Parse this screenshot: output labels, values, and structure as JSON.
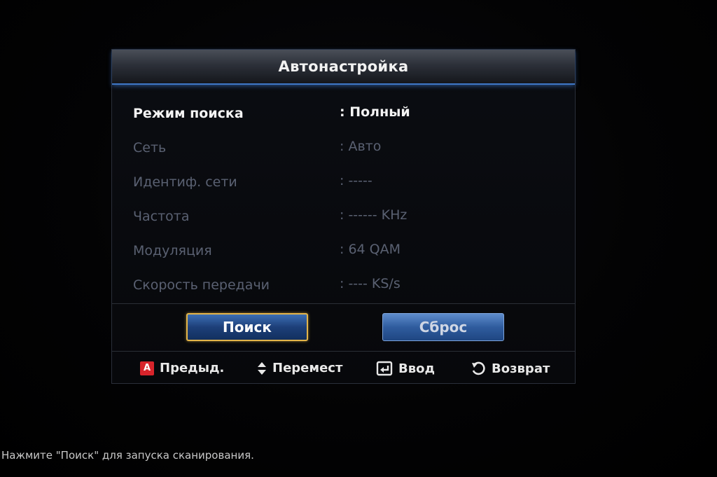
{
  "dialog": {
    "title": "Автонастройка",
    "rows": [
      {
        "label": "Режим поиска",
        "value": ": Полный",
        "active": true
      },
      {
        "label": "Сеть",
        "value": ":  Авто",
        "active": false
      },
      {
        "label": "Идентиф. сети",
        "value": ":  -----",
        "active": false
      },
      {
        "label": "Частота",
        "value": ":  ------ KHz",
        "active": false
      },
      {
        "label": "Модуляция",
        "value": ":  64 QAM",
        "active": false
      },
      {
        "label": "Скорость передачи",
        "value": ":  ---- KS/s",
        "active": false
      }
    ],
    "buttons": {
      "search": "Поиск",
      "reset": "Сброс"
    },
    "hints": {
      "prev": {
        "icon_text": "A",
        "label": "Предыд.",
        "icon": "red-a-button-icon"
      },
      "move": {
        "label": "Перемест",
        "icon": "up-down-arrows-icon"
      },
      "enter": {
        "label": "Ввод",
        "icon": "enter-icon"
      },
      "back": {
        "label": "Возврат",
        "icon": "return-icon"
      }
    }
  },
  "status": {
    "message": "Нажмите \"Поиск\" для запуска сканирования."
  },
  "colors": {
    "accent_blue": "#3f78c8",
    "focus_border": "#e3b54a",
    "red_key": "#d8242b"
  }
}
